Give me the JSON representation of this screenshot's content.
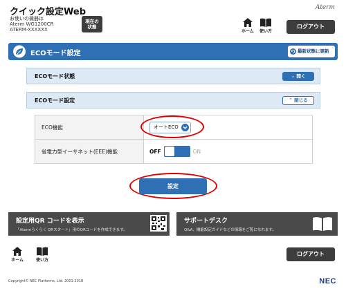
{
  "header": {
    "app_title": "クイック設定Web",
    "device_line1": "お使いの機器は",
    "device_line2": "Aterm WG1200CR",
    "device_line3": "ATERM-XXXXXX",
    "status_button_line1": "現在の",
    "status_button_line2": "状態",
    "brand": "Aterm",
    "home_label": "ホーム",
    "howto_label": "使い方",
    "logout_label": "ログアウト"
  },
  "eco_bar": {
    "title": "ECOモード設定",
    "refresh_label": "最新状態に更新"
  },
  "sections": {
    "status": {
      "title": "ECOモード状態",
      "button": "開く"
    },
    "settings": {
      "title": "ECOモード設定",
      "button": "閉じる"
    }
  },
  "settings": {
    "rows": [
      {
        "label": "ECO機能",
        "value": "オートECO"
      },
      {
        "label": "省電力型イーサネット(EEE)機能",
        "off_label": "OFF",
        "on_label": "ON"
      }
    ],
    "submit_label": "設定"
  },
  "footer": {
    "qr_title": "設定用QR コードを表示",
    "qr_desc": "「Atermらくらく QRスタート」用のQRコードを作成できます。",
    "support_title": "サポートデスク",
    "support_desc": "Q&A、機能設定ガイドなどの情報をご覧になれます。",
    "home_label": "ホーム",
    "howto_label": "使い方",
    "logout_label": "ログアウト",
    "copyright": "Copyright© NEC Platforms, Ltd. 2001-2018",
    "vendor_logo": "NEC"
  },
  "colors": {
    "accent_blue": "#2f6fb3",
    "highlight_red": "#e00000",
    "dark_button": "#3d3d3d"
  }
}
